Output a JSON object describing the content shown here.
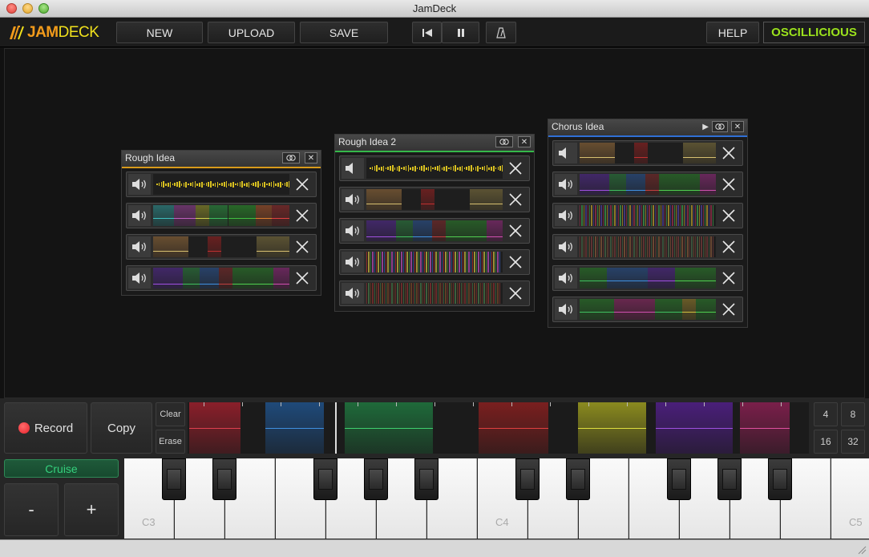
{
  "window": {
    "title": "JamDeck"
  },
  "toolbar": {
    "logo_jam": "JAM",
    "logo_deck": "DECK",
    "new_label": "NEW",
    "upload_label": "UPLOAD",
    "save_label": "SAVE",
    "help_label": "HELP",
    "brand": "OSCILLICIOUS"
  },
  "panels": [
    {
      "title": "Rough Idea",
      "accent": "#d89a1b"
    },
    {
      "title": "Rough Idea 2",
      "accent": "#35b84a"
    },
    {
      "title": "Chorus Idea",
      "accent": "#2f6fd6"
    }
  ],
  "controls": {
    "record_label": "Record",
    "copy_label": "Copy",
    "clear_label": "Clear",
    "erase_label": "Erase",
    "cruise_label": "Cruise",
    "minus_label": "-",
    "plus_label": "+",
    "grid_4": "4",
    "grid_8": "8",
    "grid_16": "16",
    "grid_32": "32"
  },
  "keyboard": {
    "c3": "C3",
    "c4": "C4",
    "c5": "C5"
  },
  "colors": {
    "brand_green": "#9be21c",
    "logo_orange": "#f29b1b",
    "logo_yellow": "#f0e01c",
    "record_red": "#e8212b"
  }
}
